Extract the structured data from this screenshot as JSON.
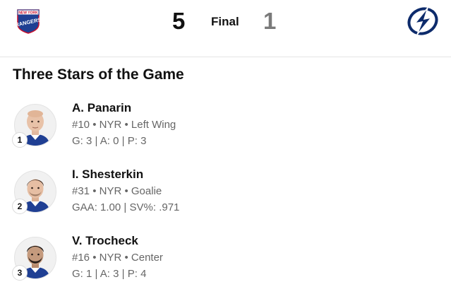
{
  "scoreboard": {
    "home_team": {
      "logo_text_top": "NEW YORK",
      "logo_text_main": "RANGERS",
      "logo_icon": "rangers-shield-logo",
      "score": "5"
    },
    "status": "Final",
    "away_team": {
      "logo_icon": "lightning-bolt-logo",
      "score": "1"
    }
  },
  "section_title": "Three Stars of the Game",
  "stars": [
    {
      "rank": "1",
      "name": "A. Panarin",
      "number": "#10",
      "team": "NYR",
      "position": "Left Wing",
      "stats": [
        {
          "label": "G",
          "value": "3"
        },
        {
          "label": "A",
          "value": "0"
        },
        {
          "label": "P",
          "value": "3"
        }
      ]
    },
    {
      "rank": "2",
      "name": "I. Shesterkin",
      "number": "#31",
      "team": "NYR",
      "position": "Goalie",
      "stats": [
        {
          "label": "GAA",
          "value": "1.00"
        },
        {
          "label": "SV%",
          "value": ".971"
        }
      ]
    },
    {
      "rank": "3",
      "name": "V. Trocheck",
      "number": "#16",
      "team": "NYR",
      "position": "Center",
      "stats": [
        {
          "label": "G",
          "value": "1"
        },
        {
          "label": "A",
          "value": "3"
        },
        {
          "label": "P",
          "value": "4"
        }
      ]
    }
  ],
  "colors": {
    "rangers_blue": "#1f3f93",
    "rangers_red": "#c8102e",
    "lightning_blue": "#0d2b6b",
    "away_score_gray": "#7a7a7a"
  }
}
